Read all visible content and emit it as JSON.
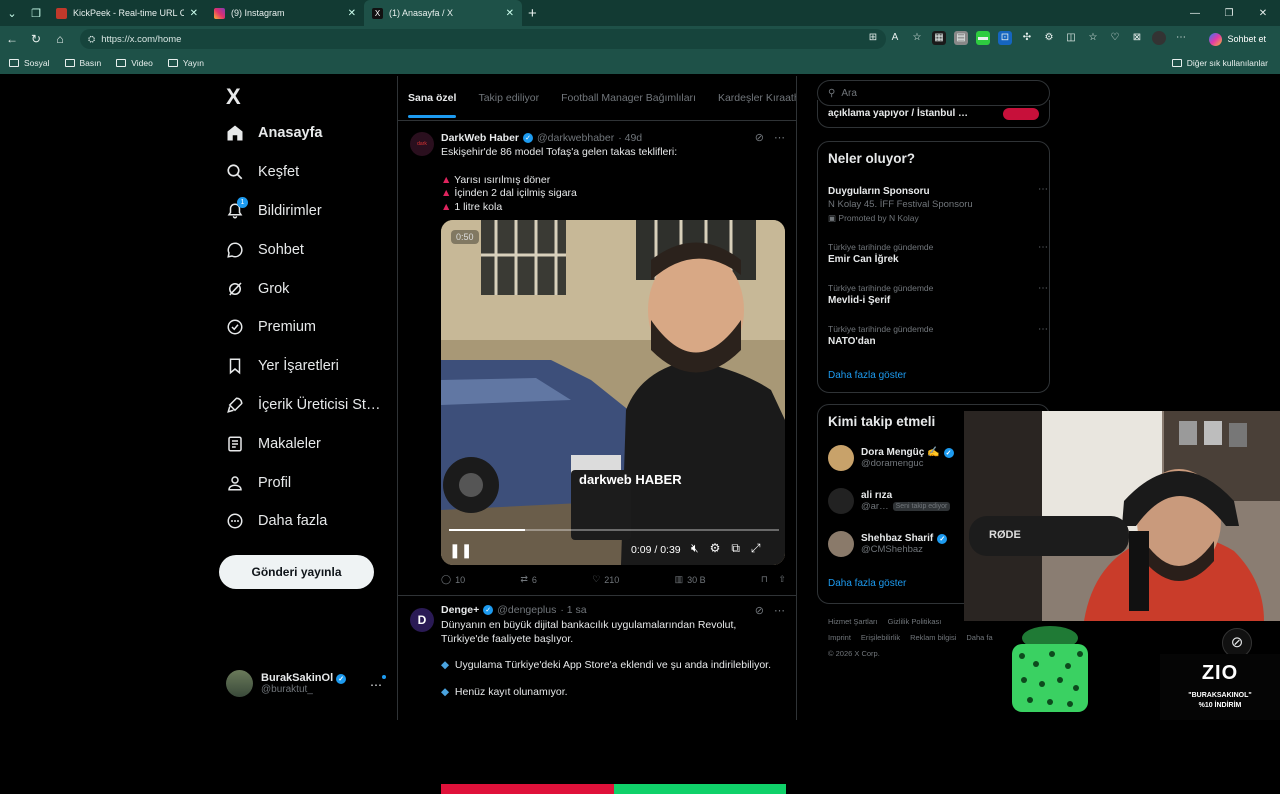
{
  "browser": {
    "tabs": [
      {
        "title": "KickPeek - Real-time URL Crawler …",
        "favicon_color": "#c0392b"
      },
      {
        "title": "(9) Instagram",
        "favicon_color": "#e1306c"
      },
      {
        "title": "(1) Anasayfa / X",
        "favicon_color": "#111111"
      }
    ],
    "url": "https://x.com/home",
    "copilot_label": "Sohbet et",
    "bookmarks": [
      "Sosyal",
      "Basın",
      "Video",
      "Yayın"
    ],
    "other_bookmarks": "Diğer sık kullanılanlar"
  },
  "nav": {
    "logo": "X",
    "items": [
      {
        "label": "Anasayfa",
        "icon": "home-icon"
      },
      {
        "label": "Keşfet",
        "icon": "search-icon"
      },
      {
        "label": "Bildirimler",
        "icon": "bell-icon",
        "badge": "1"
      },
      {
        "label": "Sohbet",
        "icon": "chat-icon"
      },
      {
        "label": "Grok",
        "icon": "grok-icon"
      },
      {
        "label": "Premium",
        "icon": "premium-icon"
      },
      {
        "label": "Yer İşaretleri",
        "icon": "bookmark-icon"
      },
      {
        "label": "İçerik Üreticisi St…",
        "icon": "rocket-icon"
      },
      {
        "label": "Makaleler",
        "icon": "article-icon"
      },
      {
        "label": "Profil",
        "icon": "user-icon"
      },
      {
        "label": "Daha fazla",
        "icon": "more-circle-icon"
      }
    ],
    "post_button": "Gönderi yayınla",
    "account": {
      "name": "BurakSakinOl",
      "handle": "@buraktut_"
    }
  },
  "feed": {
    "tabs": [
      "Sana özel",
      "Takip ediliyor",
      "Football Manager Bağımlıları",
      "Kardeşler Kıraath"
    ],
    "tweet1": {
      "name": "DarkWeb Haber",
      "handle": "@darkwebhaber",
      "time": "· 49d",
      "text": "Eskişehir'de 86 model Tofaş'a gelen takas teklifleri:",
      "bullets": [
        "Yarısı ısırılmış döner",
        "İçinden 2 dal içilmiş sigara",
        "1 litre kola"
      ],
      "video_badge": "0:50",
      "video_time": "0:09 / 0:39",
      "video_progress": 0.23,
      "video_watermark": "darkweb HABER",
      "replies": "10",
      "reposts": "6",
      "likes": "210",
      "views": "30 B"
    },
    "tweet2": {
      "name": "Denge+",
      "handle": "@dengeplus",
      "time": "· 1 sa",
      "text": "Dünyanın en büyük dijital bankacılık uygulamalarından Revolut, Türkiye'de faaliyete başlıyor.",
      "bullets": [
        "Uygulama Türkiye'deki App Store'a eklendi ve şu anda indirilebiliyor.",
        "Henüz kayıt olunamıyor."
      ]
    }
  },
  "right": {
    "search_placeholder": "Ara",
    "top_cut": "açıklama yapıyor / İstanbul …",
    "trends_title": "Neler oluyor?",
    "promo": {
      "title": "Duyguların Sponsoru",
      "sub": "N Kolay 45. İFF Festival Sponsoru",
      "promoted": "Promoted by N Kolay"
    },
    "trends": [
      {
        "ctx": "Türkiye tarihinde gündemde",
        "title": "Emir Can İğrek"
      },
      {
        "ctx": "Türkiye tarihinde gündemde",
        "title": "Mevlid-i Şerif"
      },
      {
        "ctx": "Türkiye tarihinde gündemde",
        "title": "NATO'dan"
      }
    ],
    "show_more": "Daha fazla göster",
    "who_title": "Kimi takip etmeli",
    "who": [
      {
        "name": "Dora Mengüç ✍️",
        "handle": "@doramenguc"
      },
      {
        "name": "ali rıza",
        "handle": "@ar…",
        "badge": "Seni takip ediyor"
      },
      {
        "name": "Shehbaz Sharif",
        "handle": "@CMShehbaz"
      }
    ],
    "who_more": "Daha fazla göster",
    "footer": [
      "Hizmet Şartları",
      "Gizlilik Politikası",
      "Imprint",
      "Erişilebilirlik",
      "Reklam bilgisi",
      "Daha fa",
      "© 2026 X Corp."
    ]
  },
  "overlay": {
    "mic_brand": "RØDE",
    "zio_logo": "ZIO",
    "zio_line1": "\"BURAKSAKINOL\"",
    "zio_line2": "%10 İNDİRİM"
  }
}
